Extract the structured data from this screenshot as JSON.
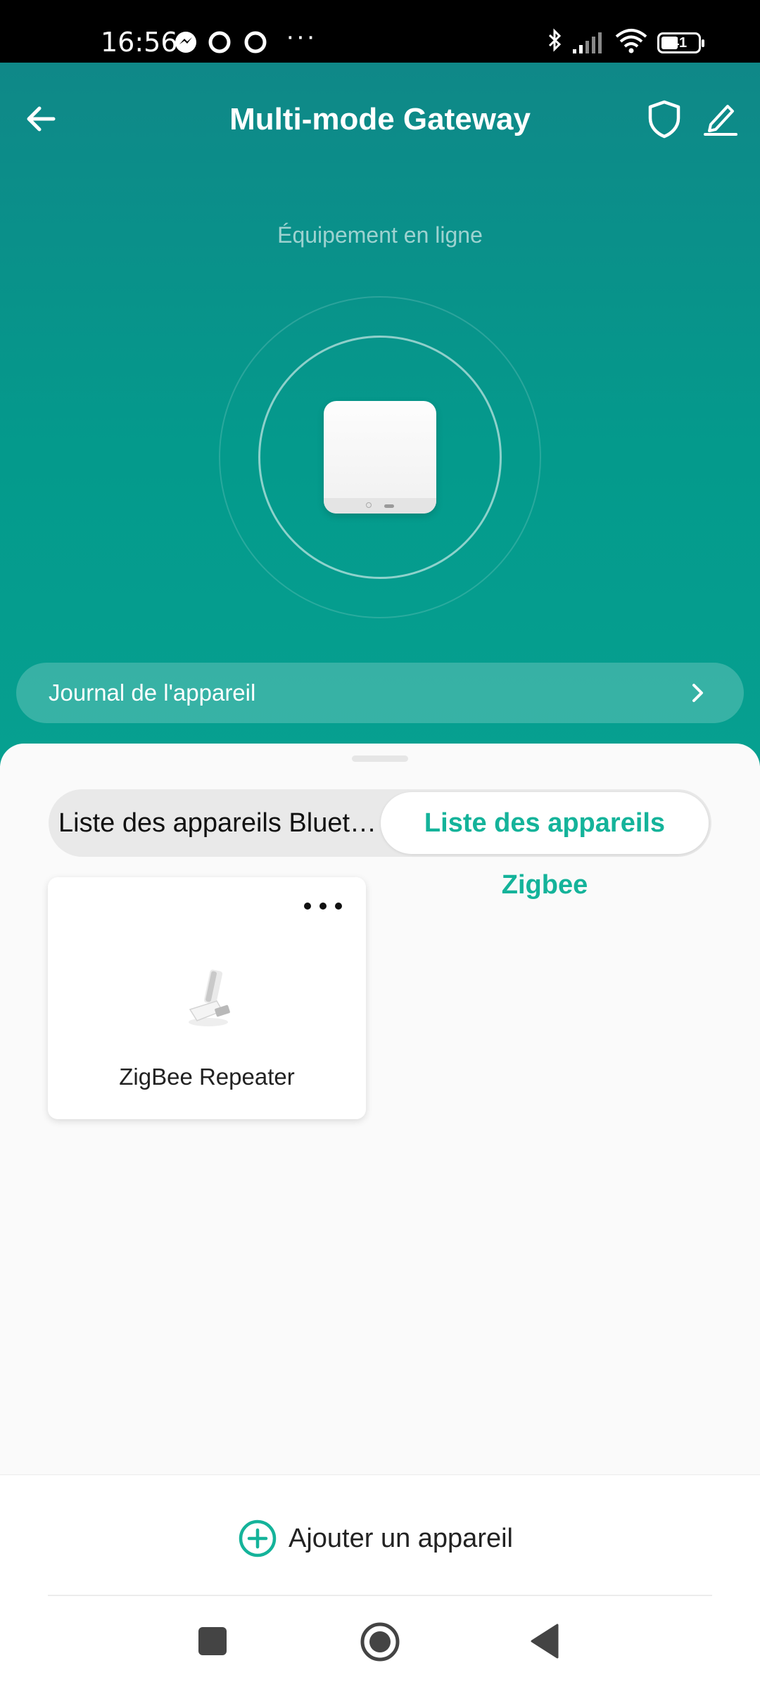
{
  "status_bar": {
    "time": "16:56",
    "dots": "···",
    "battery": "41",
    "icons": [
      "messenger-icon",
      "circle-icon",
      "circle-icon",
      "bluetooth-icon",
      "signal-icon",
      "wifi-icon",
      "battery-icon"
    ]
  },
  "header": {
    "title": "Multi-mode Gateway",
    "status": "Équipement en ligne",
    "icons": [
      "back-arrow-icon",
      "shield-icon",
      "edit-pencil-icon"
    ]
  },
  "journal": {
    "label": "Journal de l'appareil"
  },
  "tabs": {
    "bluetooth": "Liste des appareils Bluet…",
    "zigbee": "Liste des appareils Zigbee",
    "active": "zigbee"
  },
  "devices": [
    {
      "name": "ZigBee Repeater"
    }
  ],
  "bottom": {
    "add_label": "Ajouter un appareil"
  },
  "colors": {
    "accent": "#14b39a",
    "hero_top": "#0f8888",
    "hero_bottom": "#06a090"
  }
}
